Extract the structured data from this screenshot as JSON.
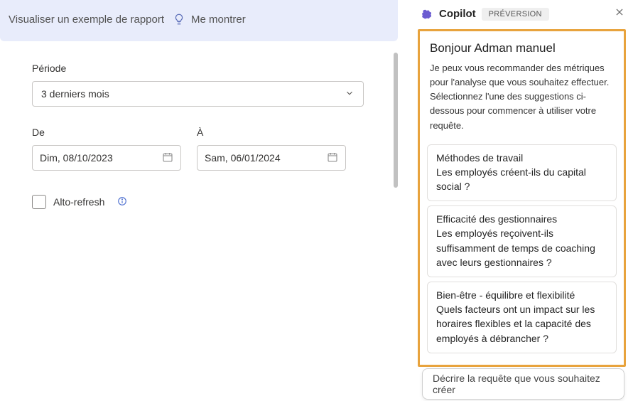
{
  "banner": {
    "example_text": "Visualiser un exemple de rapport",
    "show_me": "Me montrer"
  },
  "form": {
    "period_label": "Période",
    "period_value": "3 derniers mois",
    "from_label": "De",
    "from_value": "Dim, 08/10/2023",
    "to_label": "À",
    "to_value": "Sam, 06/01/2024",
    "auto_refresh_label": "Alto-refresh"
  },
  "copilot": {
    "title": "Copilot",
    "badge": "PRÉVERSION",
    "greeting": "Bonjour Adman manuel",
    "intro": "Je peux vous recommander des métriques pour l'analyse que vous souhaitez effectuer. Sélectionnez l'une des suggestions ci-dessous pour commencer à utiliser votre requête.",
    "suggestions": [
      {
        "title": "Méthodes de travail",
        "body": "Les employés créent-ils du capital social ?"
      },
      {
        "title": "Efficacité des gestionnaires",
        "body": "Les employés reçoivent-ils suffisamment de temps de coaching avec leurs gestionnaires ?"
      },
      {
        "title": "Bien-être - équilibre et flexibilité",
        "body": "Quels facteurs ont un impact sur les horaires flexibles et la capacité des employés à débrancher ?"
      }
    ],
    "prompt_placeholder": "Décrire la requête que vous souhaitez créer"
  }
}
